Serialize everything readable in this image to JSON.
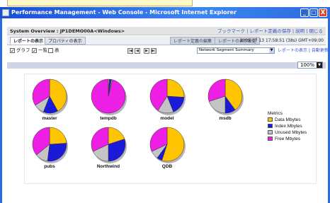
{
  "window": {
    "title": "Performance Management - Web Console - Microsoft Internet Explorer",
    "btn_min": "_",
    "btn_max": "□",
    "btn_close": "X"
  },
  "header": {
    "system_label": "System Overview : JP1DEMO00A<Windows>",
    "links": "ブックマーク | レポート定義の保存 | 説明 | 閉じる"
  },
  "tabs": {
    "report_display": "レポートの表示",
    "properties_display": "プロパティの表示",
    "edit_report_definition": "レポート定義の編集",
    "report_display_settings": "レポートの表示設定",
    "timestamp": "2009 07 13 17:58:51 (38s) GMT+09:00"
  },
  "toolbar": {
    "graph_label": "グラフ",
    "list_label": "一覧",
    "table_label": "表",
    "graph_checked": true,
    "list_checked": true,
    "table_checked": false,
    "nav_prev_icon": "|◀",
    "nav_prev2_icon": "◀",
    "nav_next_icon": "▶",
    "nav_next2_icon": "▶|",
    "segment_select_value": "Network Segment Summary",
    "right_links": "レポートの表示 | 自動更新 ◎ 停止"
  },
  "zoom": {
    "value": "100%"
  },
  "colors": {
    "data": "#ffc400",
    "index": "#1a1ad8",
    "unused": "#c4c4c4",
    "free": "#ee1fe4"
  },
  "chart_data": {
    "type": "pie",
    "legend_title": "Metrics",
    "legend_placement": "right",
    "metrics": [
      "Data Mbytes",
      "Index Mbytes",
      "Unused Mbytes",
      "Free Mbytes"
    ],
    "pies": [
      {
        "name": "master",
        "values": [
          42,
          14,
          10,
          34
        ]
      },
      {
        "name": "tempdb",
        "values": [
          1,
          2,
          1,
          96
        ]
      },
      {
        "name": "model",
        "values": [
          26,
          18,
          15,
          41
        ]
      },
      {
        "name": "msdb",
        "values": [
          40,
          10,
          20,
          30
        ]
      },
      {
        "name": "pubs",
        "values": [
          24,
          28,
          12,
          36
        ]
      },
      {
        "name": "Northwind",
        "values": [
          20,
          30,
          18,
          32
        ]
      },
      {
        "name": "QDB",
        "values": [
          55,
          5,
          8,
          32
        ]
      }
    ]
  }
}
